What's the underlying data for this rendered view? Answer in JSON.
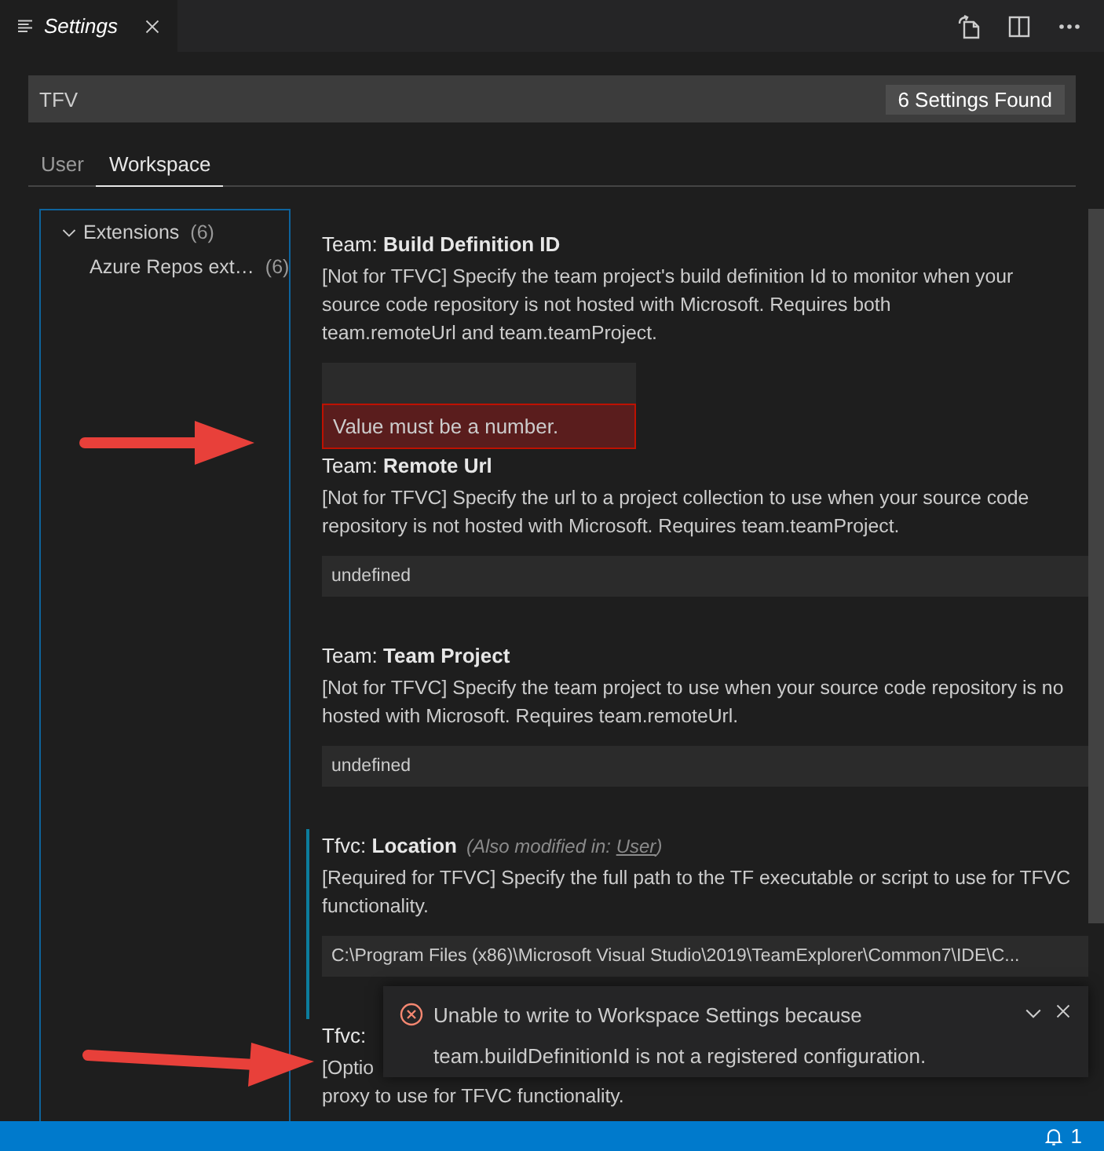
{
  "editor_tab": {
    "title": "Settings",
    "italic": true
  },
  "search": {
    "value": "TFV",
    "result_count": "6 Settings Found"
  },
  "scope_tabs": [
    {
      "label": "User",
      "selected": false
    },
    {
      "label": "Workspace",
      "selected": true
    }
  ],
  "toc": [
    {
      "label": "Extensions",
      "count": "(6)",
      "expanded": true,
      "children": [
        {
          "label": "Azure Repos ext…",
          "count": "(6)"
        }
      ]
    }
  ],
  "settings": [
    {
      "category": "Team:",
      "name": "Build Definition ID",
      "modified": false,
      "description_lines": [
        "[Not for TFVC] Specify the team project's build definition Id to monitor when your",
        "source code repository is not hosted with Microsoft. Requires both",
        "team.remoteUrl and team.teamProject."
      ],
      "kind": "number",
      "error": "Value must be a number."
    },
    {
      "category": "Team:",
      "name": "Remote Url",
      "modified": false,
      "description_lines": [
        "[Not for TFVC] Specify the url to a project collection to use when your source code",
        "repository is not hosted with Microsoft. Requires team.teamProject."
      ],
      "kind": "text",
      "value": "undefined"
    },
    {
      "category": "Team:",
      "name": "Team Project",
      "modified": false,
      "description_lines": [
        "[Not for TFVC] Specify the team project to use when your source code repository is no",
        "hosted with Microsoft. Requires team.remoteUrl."
      ],
      "kind": "text",
      "value": "undefined"
    },
    {
      "category": "Tfvc:",
      "name": "Location",
      "modified": true,
      "modified_note": "(Also modified in: ",
      "modified_link": "User",
      "modified_end": ")",
      "description_lines": [
        "[Required for TFVC] Specify the full path to the TF executable or script to use for TFVC",
        "functionality."
      ],
      "kind": "text",
      "value": "C:\\Program Files (x86)\\Microsoft Visual Studio\\2019\\TeamExplorer\\Common7\\IDE\\C..."
    },
    {
      "category": "Tfvc:",
      "modified": false,
      "description_lines": [
        "[Optio",
        "proxy to use for TFVC functionality."
      ],
      "kind": "none"
    }
  ],
  "notification": {
    "kind": "error",
    "message_lines": [
      "Unable to write to Workspace Settings because",
      "team.buildDefinitionId is not a registered configuration."
    ]
  },
  "status_bar": {
    "notifications": "1"
  }
}
